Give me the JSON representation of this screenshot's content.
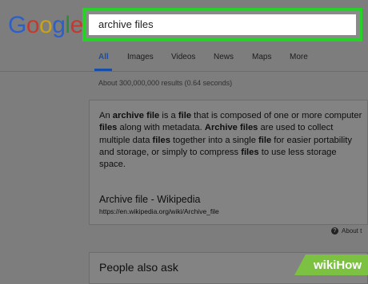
{
  "logo": {
    "letters": [
      {
        "char": "G",
        "color": "#2c5fc7"
      },
      {
        "char": "o",
        "color": "#c23a2e"
      },
      {
        "char": "o",
        "color": "#c9a21c"
      },
      {
        "char": "g",
        "color": "#2c5fc7"
      },
      {
        "char": "l",
        "color": "#2e8a3e"
      },
      {
        "char": "e",
        "color": "#c23a2e"
      }
    ]
  },
  "search": {
    "value": "archive files",
    "highlight_color": "#27d127"
  },
  "tabs": [
    {
      "label": "All",
      "active": true
    },
    {
      "label": "Images",
      "active": false
    },
    {
      "label": "Videos",
      "active": false
    },
    {
      "label": "News",
      "active": false
    },
    {
      "label": "Maps",
      "active": false
    },
    {
      "label": "More",
      "active": false
    }
  ],
  "result_stats": "About 300,000,000 results (0.64 seconds)",
  "featured_snippet": {
    "segments": [
      {
        "text": "An ",
        "bold": false
      },
      {
        "text": "archive file",
        "bold": true
      },
      {
        "text": " is a ",
        "bold": false
      },
      {
        "text": "file",
        "bold": true
      },
      {
        "text": " that is composed of one or more computer ",
        "bold": false
      },
      {
        "text": "files",
        "bold": true
      },
      {
        "text": " along with metadata. ",
        "bold": false
      },
      {
        "text": "Archive files",
        "bold": true
      },
      {
        "text": " are used to collect multiple data ",
        "bold": false
      },
      {
        "text": "files",
        "bold": true
      },
      {
        "text": " together into a single ",
        "bold": false
      },
      {
        "text": "file",
        "bold": true
      },
      {
        "text": " for easier portability and storage, or simply to compress ",
        "bold": false
      },
      {
        "text": "files",
        "bold": true
      },
      {
        "text": " to use less storage space.",
        "bold": false
      }
    ],
    "source_title": "Archive file - Wikipedia",
    "source_url": "https://en.wikipedia.org/wiki/Archive_file"
  },
  "about_link": "About t",
  "people_also_ask": "People also ask",
  "watermark": {
    "text": "wikiHow",
    "color": "#7cc142"
  }
}
